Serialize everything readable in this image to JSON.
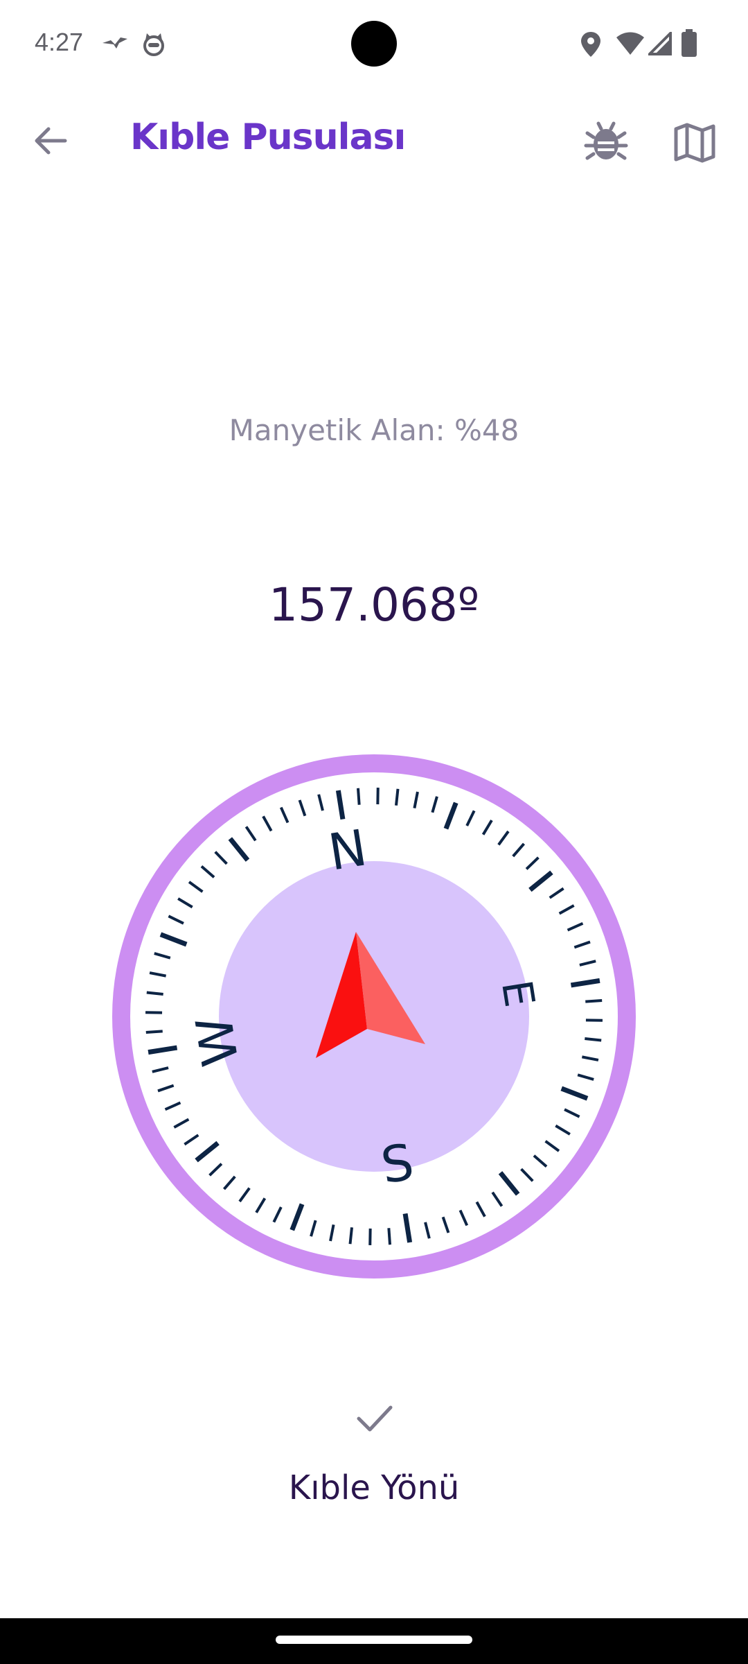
{
  "status_bar": {
    "time": "4:27",
    "icons": [
      "bird-notification-icon",
      "cat-notification-icon",
      "location-icon",
      "wifi-icon",
      "signal-icon",
      "battery-icon"
    ]
  },
  "app_bar": {
    "title": "Kıble Pusulası",
    "back_icon": "arrow-left-icon",
    "actions": [
      "bug-icon",
      "map-icon"
    ]
  },
  "magnetic_field": {
    "text": "Manyetik Alan: %48",
    "value_percent": 48
  },
  "heading": {
    "text": "157.068º",
    "degrees": 157.068
  },
  "compass": {
    "rotation_deg": -9,
    "cardinals": [
      "N",
      "E",
      "S",
      "W"
    ],
    "colors": {
      "outer_ring": "#cc8ef2",
      "inner_disc": "#d8c4fc",
      "ticks": "#0d2444",
      "arrow_dark": "#fa1010",
      "arrow_light": "#fb6060"
    }
  },
  "qibla": {
    "icon": "check-icon",
    "label": "Kıble Yönü"
  },
  "colors": {
    "title": "#6a35c9",
    "text_dark": "#2a154d",
    "text_muted": "#8e8a9f"
  }
}
